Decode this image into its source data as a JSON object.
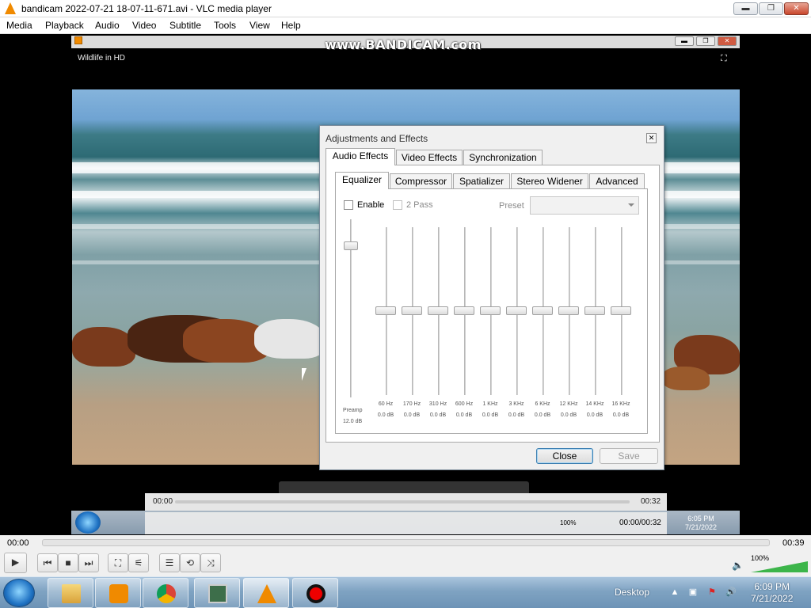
{
  "window": {
    "title": "bandicam 2022-07-21 18-07-11-671.avi - VLC media player",
    "buttons": {
      "minimize": "▬",
      "maximize": "❐",
      "close": "✕"
    }
  },
  "menu": [
    "Media",
    "Playback",
    "Audio",
    "Video",
    "Subtitle",
    "Tools",
    "View",
    "Help"
  ],
  "video": {
    "watermark": "www.BANDICAM.com",
    "inner_title": "Wildlife in HD"
  },
  "dialog": {
    "title": "Adjustments and Effects",
    "main_tabs": [
      "Audio Effects",
      "Video Effects",
      "Synchronization"
    ],
    "sub_tabs": [
      "Equalizer",
      "Compressor",
      "Spatializer",
      "Stereo Widener",
      "Advanced"
    ],
    "enable_label": "Enable",
    "twopass_label": "2 Pass",
    "preset_label": "Preset",
    "preset_value": "",
    "preamp": {
      "label": "Preamp",
      "value": "12.0 dB",
      "level": 0.85
    },
    "bands": [
      {
        "freq": "60 Hz",
        "db": "0.0 dB"
      },
      {
        "freq": "170 Hz",
        "db": "0.0 dB"
      },
      {
        "freq": "310 Hz",
        "db": "0.0 dB"
      },
      {
        "freq": "600 Hz",
        "db": "0.0 dB"
      },
      {
        "freq": "1 KHz",
        "db": "0.0 dB"
      },
      {
        "freq": "3 KHz",
        "db": "0.0 dB"
      },
      {
        "freq": "6 KHz",
        "db": "0.0 dB"
      },
      {
        "freq": "12 KHz",
        "db": "0.0 dB"
      },
      {
        "freq": "14 KHz",
        "db": "0.0 dB"
      },
      {
        "freq": "16 KHz",
        "db": "0.0 dB"
      }
    ],
    "close_label": "Close",
    "save_label": "Save"
  },
  "inner_player": {
    "elapsed": "00:00",
    "total": "00:32",
    "time_display": "00:00/00:32",
    "volume": "100%",
    "clock_time": "6:05 PM",
    "clock_date": "7/21/2022"
  },
  "player": {
    "elapsed": "00:00",
    "total": "00:39",
    "progress": 0.0,
    "volume": "100%",
    "volume_level": 1.0
  },
  "taskbar": {
    "desktop_label": "Desktop",
    "clock_time": "6:09 PM",
    "clock_date": "7/21/2022"
  }
}
